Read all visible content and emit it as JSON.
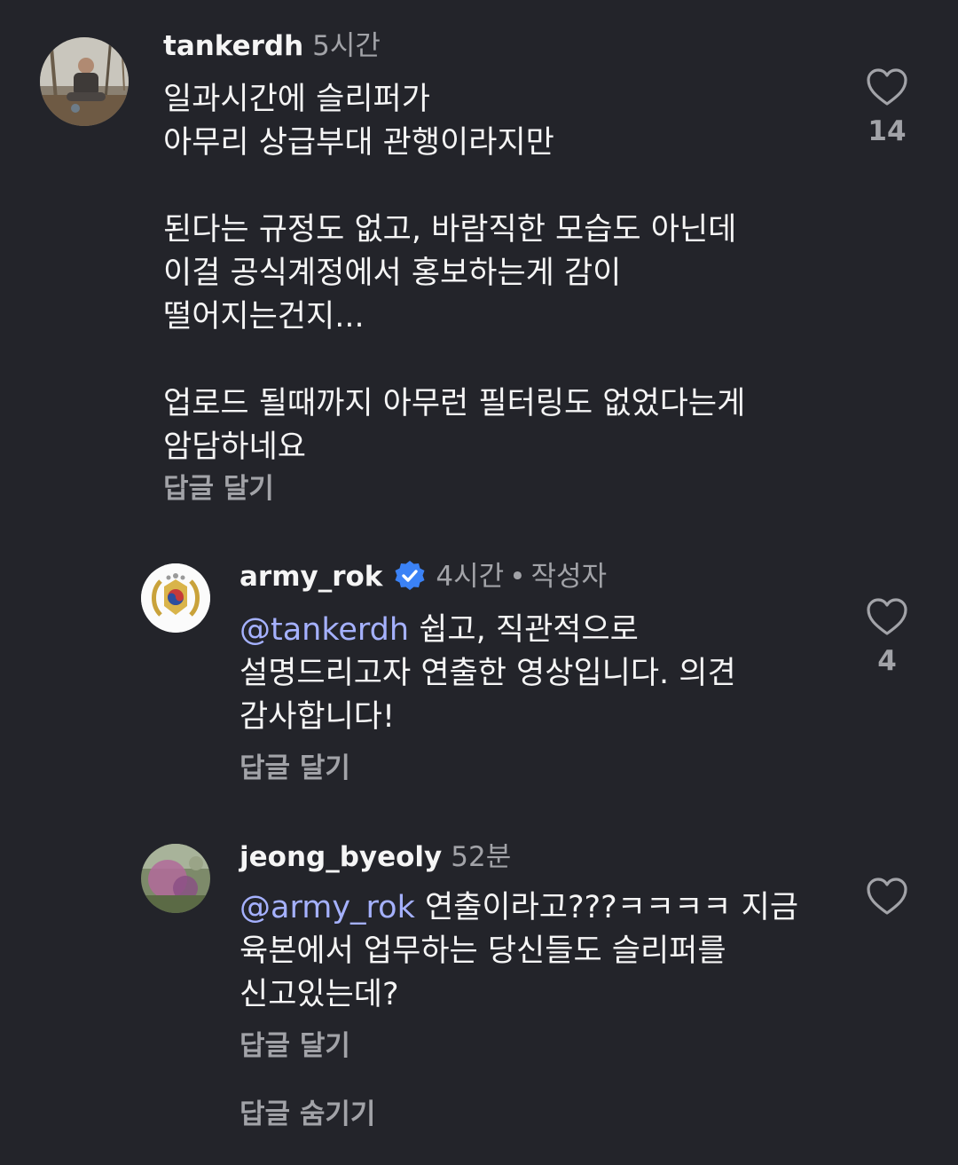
{
  "comments": [
    {
      "username": "tankerdh",
      "time": "5시간",
      "text": "일과시간에 슬리퍼가\n아무리 상급부대 관행이라지만\n\n된다는 규정도 없고, 바람직한 모습도 아닌데\n이걸 공식계정에서 홍보하는게 감이\n떨어지는건지...\n\n업로드 될때까지 아무런 필터링도 없었다는게\n암담하네요",
      "reply_label": "답글 달기",
      "like_count": "14",
      "icons": {
        "avatar": "user-photo-avatar",
        "like": "heart-outline-icon"
      }
    },
    {
      "username": "army_rok",
      "verified": true,
      "time": "4시간",
      "separator": "•",
      "author_label": "작성자",
      "mention": "@tankerdh",
      "text": " 쉽고, 직관적으로\n설명드리고자 연출한 영상입니다. 의견\n감사합니다!",
      "reply_label": "답글 달기",
      "like_count": "4",
      "icons": {
        "avatar": "army-emblem-avatar",
        "verified": "verified-badge-icon",
        "like": "heart-outline-icon"
      }
    },
    {
      "username": "jeong_byeoly",
      "time": "52분",
      "mention": "@army_rok",
      "text": " 연출이라고???ㅋㅋㅋㅋ 지금\n육본에서 업무하는 당신들도 슬리퍼를\n신고있는데?",
      "reply_label": "답글 달기",
      "like_count": "",
      "icons": {
        "avatar": "user-photo-avatar",
        "like": "heart-outline-icon"
      }
    }
  ],
  "hide_replies_label": "답글 숨기기",
  "colors": {
    "background": "#23242a",
    "text": "#f5f5f5",
    "secondary": "#a2a3a8",
    "mention": "#a5b1ff",
    "verified": "#3b82f6"
  }
}
